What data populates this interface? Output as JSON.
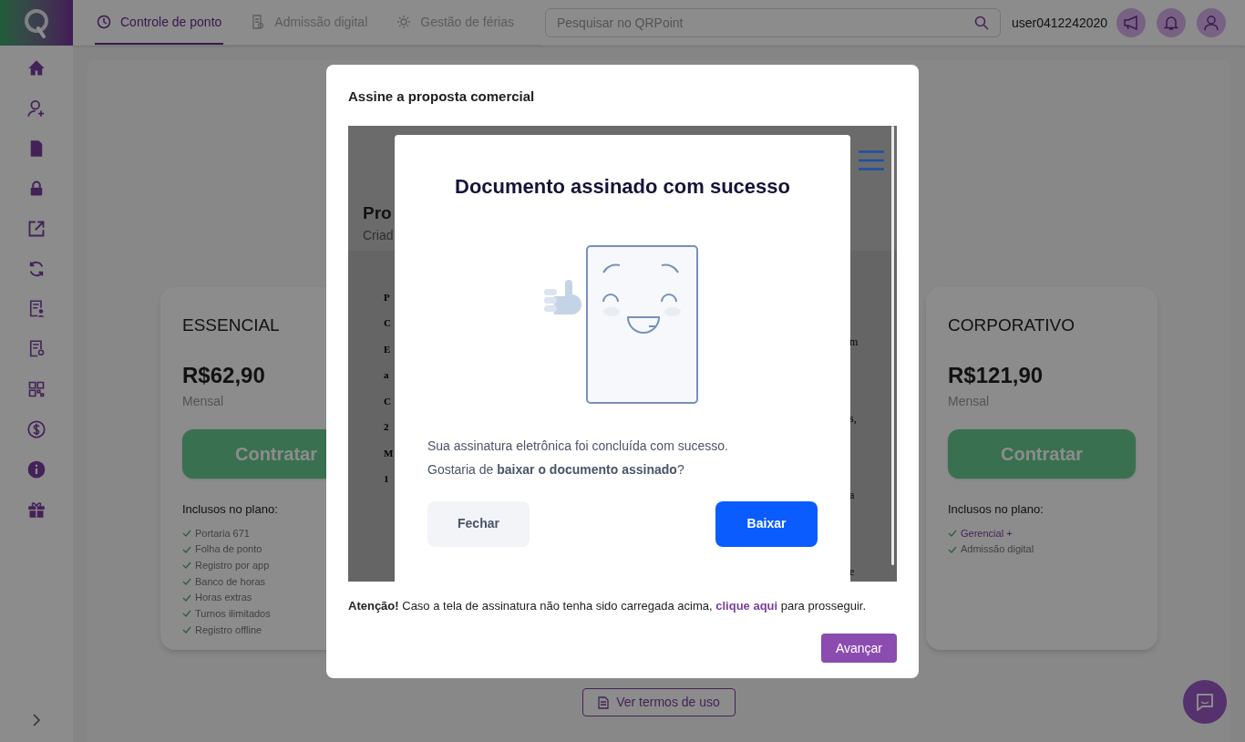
{
  "topbar": {
    "tabs": [
      {
        "label": "Controle de ponto",
        "selected": true
      },
      {
        "label": "Admissão digital",
        "selected": false
      },
      {
        "label": "Gestão de férias",
        "selected": false
      }
    ],
    "search": {
      "placeholder": "Pesquisar no QRPoint"
    },
    "username": "user0412242020"
  },
  "plans": [
    {
      "name": "ESSENCIAL",
      "price": "R$62,90",
      "period": "Mensal",
      "button": "Contratar",
      "included_label": "Inclusos no plano:",
      "features": [
        {
          "text": "Portaria 671",
          "kind": "plain"
        },
        {
          "text": "Folha de ponto",
          "kind": "plain"
        },
        {
          "text": "Registro por app",
          "kind": "plain"
        },
        {
          "text": "Banco de horas",
          "kind": "plain"
        },
        {
          "text": "Horas extras",
          "kind": "plain"
        },
        {
          "text": "Turnos ilimitados",
          "kind": "plain"
        },
        {
          "text": "Registro offline",
          "kind": "plain"
        }
      ]
    },
    {
      "name": "CORPORATIVO",
      "price": "R$121,90",
      "period": "Mensal",
      "button": "Contratar",
      "included_label": "Inclusos no plano:",
      "features": [
        {
          "text": "Gerencial +",
          "kind": "link"
        },
        {
          "text": "Admissão digital",
          "kind": "plain"
        }
      ]
    }
  ],
  "terms_button": "Ver termos de uso",
  "modal": {
    "title": "Assine a proposta comercial",
    "embedded": {
      "doc_title": "Pro",
      "doc_subtitle": "Criad",
      "left_fragments": [
        "P",
        "C",
        "E",
        "a",
        "C",
        "2",
        "M",
        "1"
      ],
      "right_fragments": [
        "m",
        "s,",
        "a",
        "e"
      ],
      "dialog": {
        "title": "Documento assinado com sucesso",
        "message_lines": [
          "Sua assinatura eletrônica foi concluída com sucesso.",
          "Gostaria de **baixar o documento assinado**?"
        ],
        "buttons": [
          {
            "label": "Fechar",
            "kind": "secondary"
          },
          {
            "label": "Baixar",
            "kind": "primary"
          }
        ]
      }
    },
    "notice_before": "**Atenção!** Caso a tela de assinatura não tenha sido carregada acima,",
    "notice_link": "clique aqui",
    "notice_after": "para prosseguir.",
    "button": "Avançar"
  }
}
